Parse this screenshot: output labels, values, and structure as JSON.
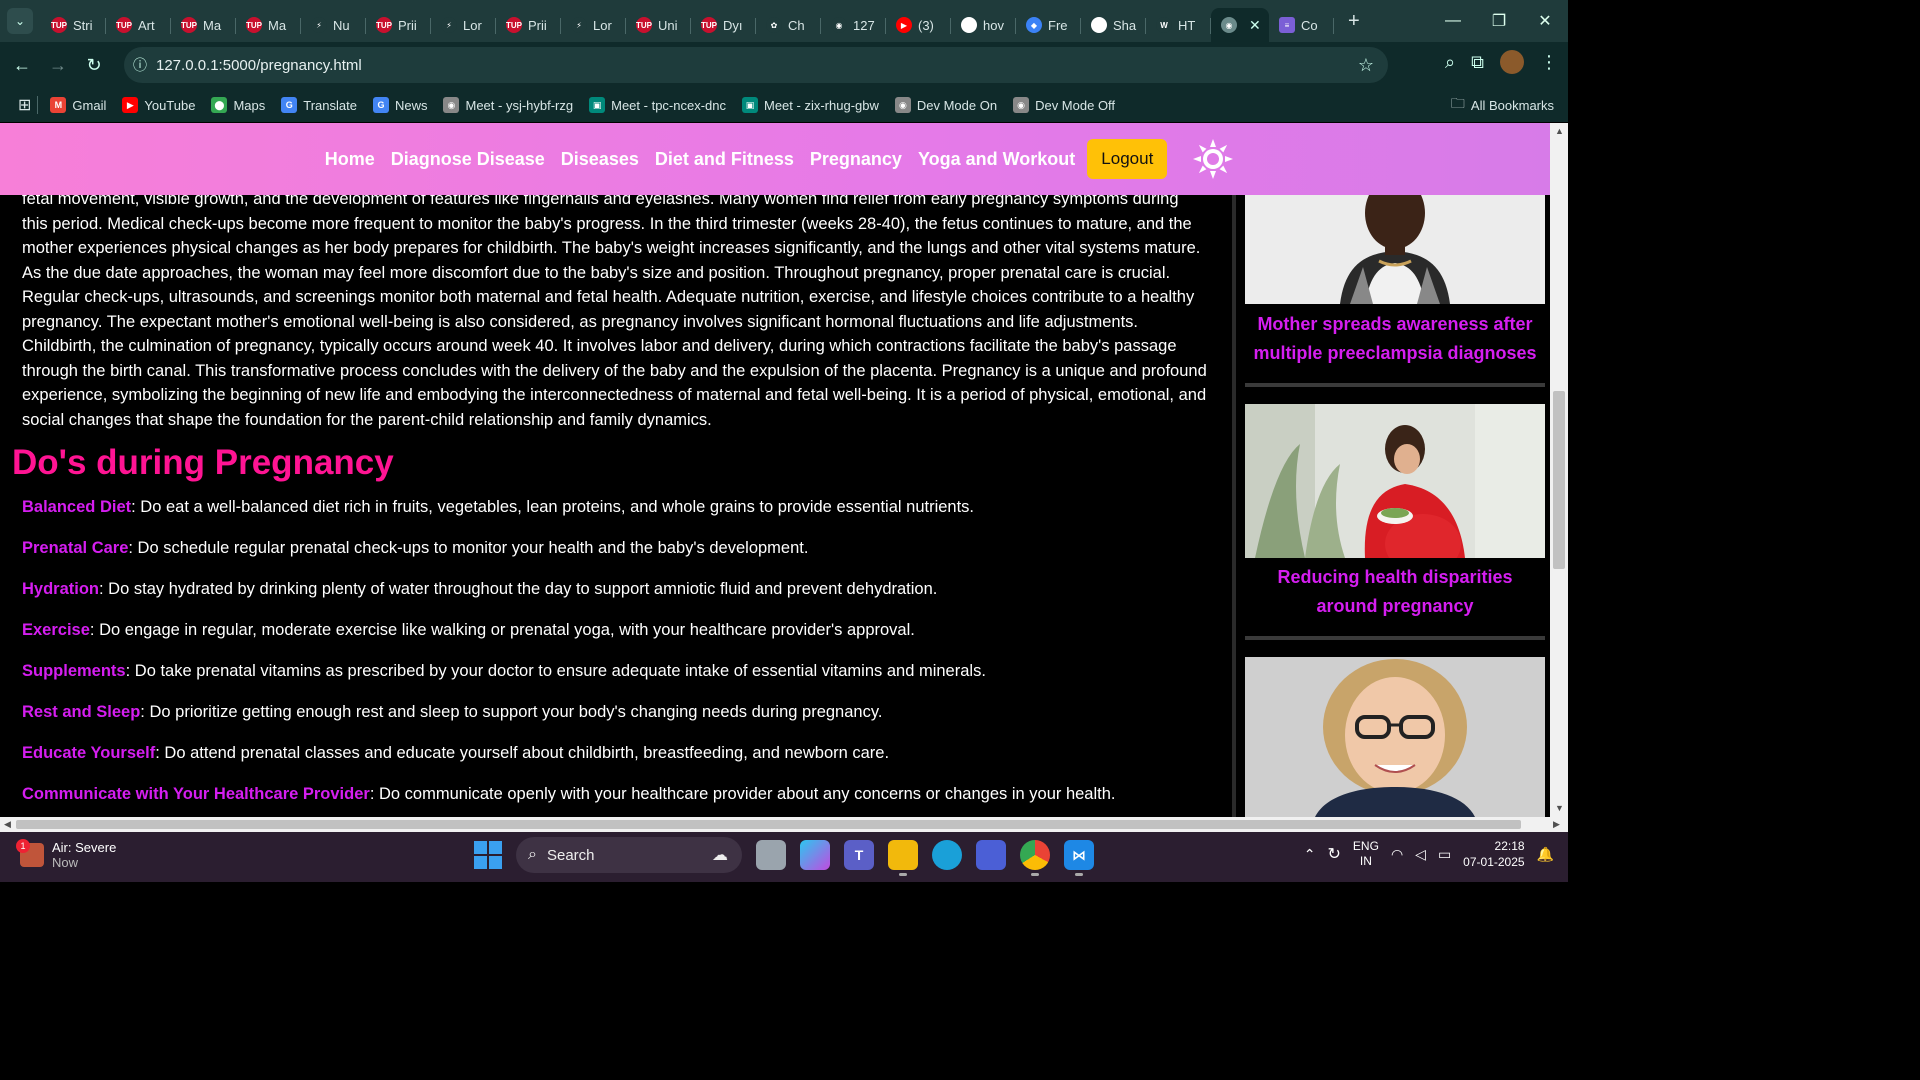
{
  "browser": {
    "tabs": [
      {
        "label": "Stri",
        "fav": "TUP",
        "color": "#c8102e"
      },
      {
        "label": "Art",
        "fav": "TUP",
        "color": "#c8102e"
      },
      {
        "label": "Ma",
        "fav": "TUP",
        "color": "#c8102e"
      },
      {
        "label": "Ma",
        "fav": "TUP",
        "color": "#c8102e"
      },
      {
        "label": "Nu",
        "fav": "⚡",
        "color": "#1f3b3b"
      },
      {
        "label": "Prii",
        "fav": "TUP",
        "color": "#c8102e"
      },
      {
        "label": "Lor",
        "fav": "⚡",
        "color": "#1f3b3b"
      },
      {
        "label": "Prii",
        "fav": "TUP",
        "color": "#c8102e"
      },
      {
        "label": "Lor",
        "fav": "⚡",
        "color": "#1f3b3b"
      },
      {
        "label": "Uni",
        "fav": "TUP",
        "color": "#c8102e"
      },
      {
        "label": "Dyı",
        "fav": "TUP",
        "color": "#c8102e"
      },
      {
        "label": "Ch",
        "fav": "✿",
        "color": "#1f3b3b"
      },
      {
        "label": "127",
        "fav": "◉",
        "color": "#1f3b3b"
      },
      {
        "label": "(3)",
        "fav": "▶",
        "color": "#ff0000"
      },
      {
        "label": "hov",
        "fav": "G",
        "color": "#ffffff"
      },
      {
        "label": "Fre",
        "fav": "◆",
        "color": "#3b82f6"
      },
      {
        "label": "Sha",
        "fav": "◎",
        "color": "#ffffff"
      },
      {
        "label": "HT",
        "fav": "W",
        "color": "#1f3b3b"
      }
    ],
    "active_tab": {
      "label": "",
      "close": "✕"
    },
    "last_tab": {
      "label": "Co"
    },
    "new_tab": "+",
    "url": "127.0.0.1:5000/pregnancy.html",
    "bookmarks": [
      {
        "label": "Gmail",
        "icon": "M",
        "color": "#ea4335"
      },
      {
        "label": "YouTube",
        "icon": "▶",
        "color": "#ff0000"
      },
      {
        "label": "Maps",
        "icon": "⬤",
        "color": "#34a853"
      },
      {
        "label": "Translate",
        "icon": "G",
        "color": "#4285f4"
      },
      {
        "label": "News",
        "icon": "G",
        "color": "#4285f4"
      },
      {
        "label": "Meet - ysj-hybf-rzg",
        "icon": "◉",
        "color": "#888888"
      },
      {
        "label": "Meet - tpc-ncex-dnc",
        "icon": "▣",
        "color": "#00897b"
      },
      {
        "label": "Meet - zix-rhug-gbw",
        "icon": "▣",
        "color": "#00897b"
      },
      {
        "label": "Dev Mode On",
        "icon": "◉",
        "color": "#888888"
      },
      {
        "label": "Dev Mode Off",
        "icon": "◉",
        "color": "#888888"
      }
    ],
    "all_bookmarks": "All Bookmarks"
  },
  "nav": {
    "links": [
      "Home",
      "Diagnose Disease",
      "Diseases",
      "Diet and Fitness",
      "Pregnancy",
      "Yoga and Workout"
    ],
    "logout": "Logout"
  },
  "content": {
    "paragraph": "fetal movement, visible growth, and the development of features like fingernails and eyelashes. Many women find relief from early pregnancy symptoms during this period. Medical check-ups become more frequent to monitor the baby's progress. In the third trimester (weeks 28-40), the fetus continues to mature, and the mother experiences physical changes as her body prepares for childbirth. The baby's weight increases significantly, and the lungs and other vital systems mature. As the due date approaches, the woman may feel more discomfort due to the baby's size and position. Throughout pregnancy, proper prenatal care is crucial. Regular check-ups, ultrasounds, and screenings monitor both maternal and fetal health. Adequate nutrition, exercise, and lifestyle choices contribute to a healthy pregnancy. The expectant mother's emotional well-being is also considered, as pregnancy involves significant hormonal fluctuations and life adjustments. Childbirth, the culmination of pregnancy, typically occurs around week 40. It involves labor and delivery, during which contractions facilitate the baby's passage through the birth canal. This transformative process concludes with the delivery of the baby and the expulsion of the placenta. Pregnancy is a unique and profound experience, symbolizing the beginning of new life and embodying the interconnectedness of maternal and fetal well-being. It is a period of physical, emotional, and social changes that shape the foundation for the parent-child relationship and family dynamics.",
    "dos_heading": "Do's during Pregnancy",
    "dos": [
      {
        "key": "Balanced Diet",
        "text": ": Do eat a well-balanced diet rich in fruits, vegetables, lean proteins, and whole grains to provide essential nutrients."
      },
      {
        "key": "Prenatal Care",
        "text": ": Do schedule regular prenatal check-ups to monitor your health and the baby's development."
      },
      {
        "key": "Hydration",
        "text": ": Do stay hydrated by drinking plenty of water throughout the day to support amniotic fluid and prevent dehydration."
      },
      {
        "key": "Exercise",
        "text": ": Do engage in regular, moderate exercise like walking or prenatal yoga, with your healthcare provider's approval."
      },
      {
        "key": "Supplements",
        "text": ": Do take prenatal vitamins as prescribed by your doctor to ensure adequate intake of essential vitamins and minerals."
      },
      {
        "key": "Rest and Sleep",
        "text": ": Do prioritize getting enough rest and sleep to support your body's changing needs during pregnancy."
      },
      {
        "key": "Educate Yourself",
        "text": ": Do attend prenatal classes and educate yourself about childbirth, breastfeeding, and newborn care."
      },
      {
        "key": "Communicate with Your Healthcare Provider",
        "text": ": Do communicate openly with your healthcare provider about any concerns or changes in your health."
      }
    ]
  },
  "sidebar": {
    "articles": [
      {
        "title": "Mother spreads awareness after multiple preeclampsia diagnoses"
      },
      {
        "title": "Reducing health disparities around pregnancy"
      },
      {
        "title": ""
      }
    ]
  },
  "taskbar": {
    "weather_title": "Air: Severe",
    "weather_sub": "Now",
    "weather_badge": "1",
    "search": "Search",
    "lang_top": "ENG",
    "lang_bottom": "IN",
    "time": "22:18",
    "date": "07-01-2025"
  },
  "colors": {
    "nav_gradient_start": "#f77fd8",
    "nav_gradient_end": "#d77be8",
    "heading": "#ff1493",
    "accent": "#d51ef0",
    "logout_bg": "#ffc107"
  }
}
